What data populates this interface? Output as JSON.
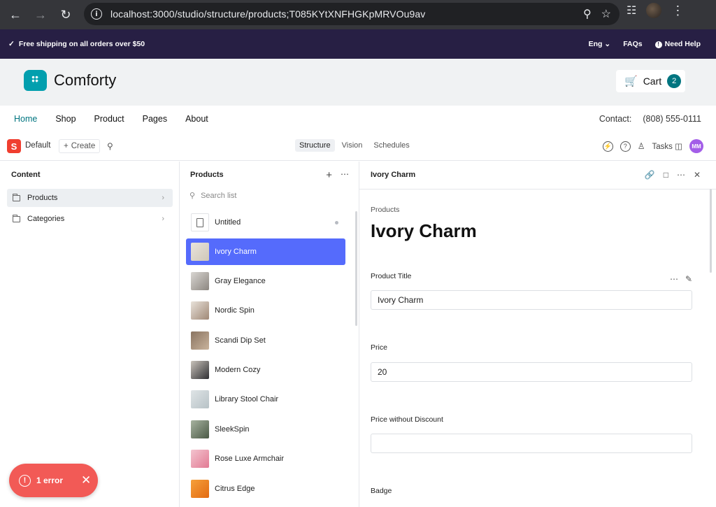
{
  "browser": {
    "url": "localhost:3000/studio/structure/products;T085KYtXNFHGKpMRVOu9av"
  },
  "announce": {
    "shipping": "Free shipping on all orders over $50",
    "lang": "Eng",
    "faqs": "FAQs",
    "help": "Need Help"
  },
  "site": {
    "brand": "Comforty",
    "cart_label": "Cart",
    "cart_count": "2",
    "nav": [
      "Home",
      "Shop",
      "Product",
      "Pages",
      "About"
    ],
    "contact_label": "Contact:",
    "contact_phone": "(808) 555-0111",
    "accent": "#007580",
    "logo_color": "#029fae"
  },
  "studio": {
    "workspace": "Default",
    "create": "Create",
    "tabs": [
      "Structure",
      "Vision",
      "Schedules"
    ],
    "tasks": "Tasks",
    "avatar": "MM",
    "brand_color": "#f03e2f"
  },
  "content_pane": {
    "title": "Content",
    "items": [
      "Products",
      "Categories"
    ]
  },
  "products_pane": {
    "title": "Products",
    "search_placeholder": "Search list",
    "items": [
      "Untitled",
      "Ivory Charm",
      "Gray Elegance",
      "Nordic Spin",
      "Scandi Dip Set",
      "Modern Cozy",
      "Library Stool Chair",
      "SleekSpin",
      "Rose Luxe Armchair",
      "Citrus Edge"
    ],
    "selected_color": "#556bfc"
  },
  "document": {
    "header": "Ivory Charm",
    "type": "Products",
    "title": "Ivory Charm",
    "fields": {
      "product_title_label": "Product Title",
      "product_title_value": "Ivory Charm",
      "price_label": "Price",
      "price_value": "20",
      "price_wo_discount_label": "Price without Discount",
      "price_wo_discount_value": "",
      "badge_label": "Badge"
    }
  },
  "toast": {
    "text": "1 error",
    "color": "#f25a56"
  }
}
